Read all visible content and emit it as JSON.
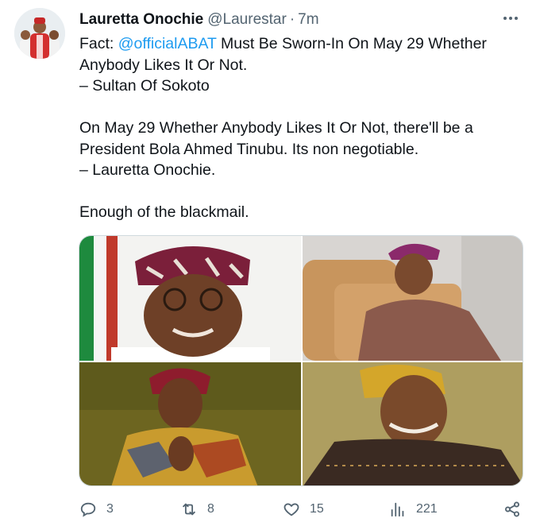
{
  "tweet": {
    "author_name": "Lauretta Onochie",
    "author_handle": "@Laurestar",
    "separator": "·",
    "time": "7m",
    "lines": {
      "l1_prefix": "Fact: ",
      "l1_mention": "@officialABAT",
      "l1_suffix": " Must Be Sworn-In On May 29 Whether",
      "l2": "Anybody Likes It Or Not.",
      "l3": "– Sultan Of Sokoto",
      "l4": "On May 29 Whether Anybody Likes It Or Not, there'll be a",
      "l5": "President Bola Ahmed Tinubu. Its non negotiable.",
      "l6": "– Lauretta Onochie.",
      "l7": "Enough of the blackmail."
    }
  },
  "metrics": {
    "replies": "3",
    "retweets": "8",
    "likes": "15",
    "views": "221"
  },
  "icons": {
    "more": "more-horizontal-icon",
    "reply": "reply-icon",
    "retweet": "retweet-icon",
    "like": "heart-icon",
    "views": "views-bar-chart-icon",
    "share": "share-icon"
  },
  "colors": {
    "accent": "#1d9bf0",
    "text": "#0f1419",
    "secondary": "#536471",
    "border": "#cfd9de"
  }
}
